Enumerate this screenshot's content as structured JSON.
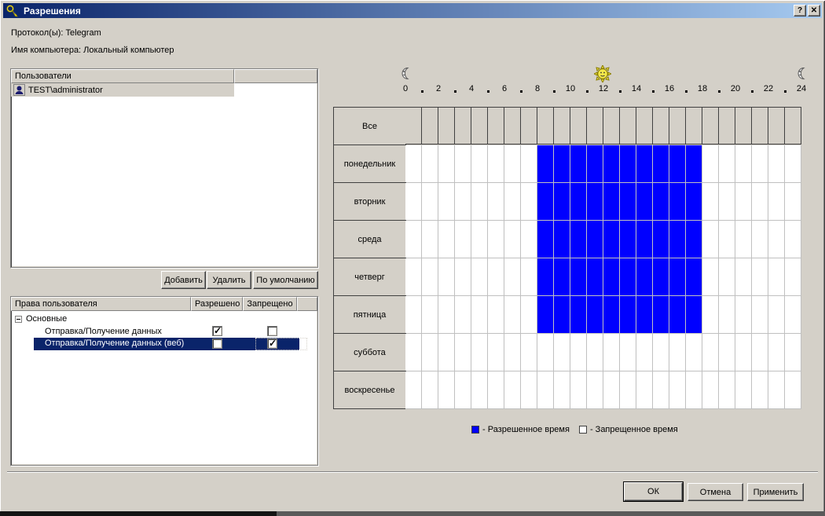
{
  "window": {
    "title": "Разрешения",
    "help_label": "?",
    "close_label": "✕"
  },
  "header": {
    "protocols_label": "Протокол(ы): Telegram",
    "computer_label": "Имя компьютера: Локальный компьютер"
  },
  "users_panel": {
    "column_header": "Пользователи",
    "rows": [
      {
        "name": "TEST\\administrator"
      }
    ]
  },
  "user_buttons": {
    "add": "Добавить",
    "remove": "Удалить",
    "default": "По умолчанию"
  },
  "rights_table": {
    "headers": [
      "Права пользователя",
      "Разрешено",
      "Запрещено"
    ],
    "rows": [
      {
        "label": "Основные",
        "type": "group",
        "expanded": true
      },
      {
        "label": "Отправка/Получение данных",
        "allowed": true,
        "denied": false,
        "selected": false
      },
      {
        "label": "Отправка/Получение данных (веб)",
        "allowed": false,
        "denied": true,
        "selected": true
      }
    ]
  },
  "schedule": {
    "hour_labels": [
      "0",
      "2",
      "4",
      "6",
      "8",
      "10",
      "12",
      "14",
      "16",
      "18",
      "20",
      "22",
      "24"
    ],
    "hours_total": 24,
    "all_row_label": "Все",
    "days": [
      "понедельник",
      "вторник",
      "среда",
      "четверг",
      "пятница",
      "суббота",
      "воскресенье"
    ],
    "allowed_block": {
      "day_from": "понедельник",
      "day_to": "пятница",
      "day_indices": [
        0,
        1,
        2,
        3,
        4
      ],
      "from_hour": 8,
      "to_hour": 18
    },
    "allowed_color": "#0000ff",
    "denied_color": "#ffffff",
    "legend": [
      {
        "label": "- Разрешенное время",
        "color": "#0000ff"
      },
      {
        "label": "- Запрещенное время",
        "color": "#ffffff"
      }
    ]
  },
  "footer": {
    "ok": "ОК",
    "cancel": "Отмена",
    "apply": "Применить"
  }
}
